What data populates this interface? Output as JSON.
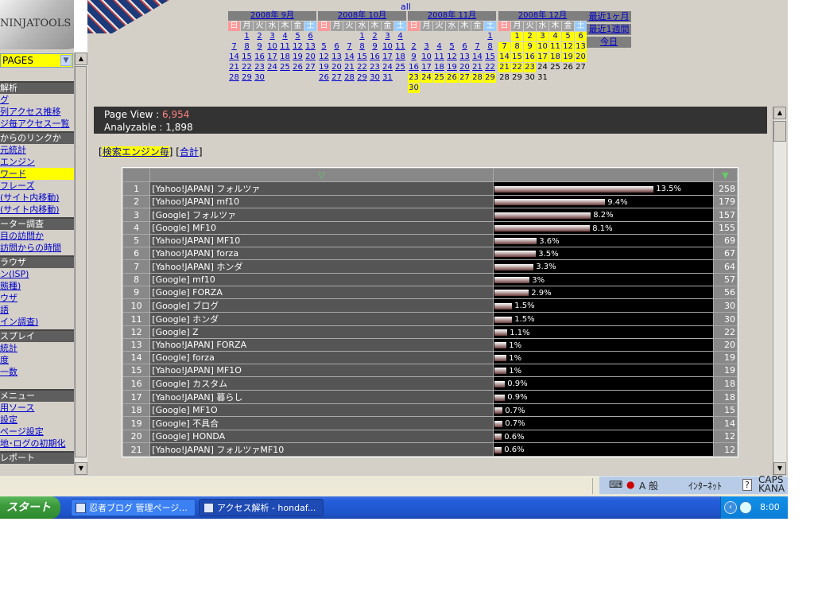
{
  "sidebar": {
    "logo_text": "NINJATOOLS",
    "page_select": "PAGES",
    "menu": [
      {
        "type": "head",
        "label": "解析"
      },
      {
        "type": "item",
        "label": "グ"
      },
      {
        "type": "item",
        "label": "列アクセス推移"
      },
      {
        "type": "item",
        "label": "ジ毎アクセス一覧"
      },
      {
        "type": "head",
        "label": "からのリンクか"
      },
      {
        "type": "item",
        "label": "元統計"
      },
      {
        "type": "item",
        "label": "エンジン"
      },
      {
        "type": "item",
        "label": "ワード",
        "highlight": true
      },
      {
        "type": "item",
        "label": "フレーズ"
      },
      {
        "type": "item",
        "label": "(サイト内移動)"
      },
      {
        "type": "item",
        "label": "(サイト内移動)"
      },
      {
        "type": "head",
        "label": "ーター調査"
      },
      {
        "type": "item",
        "label": "目の訪問か"
      },
      {
        "type": "item",
        "label": "訪問からの時間"
      },
      {
        "type": "head",
        "label": "ラウザ"
      },
      {
        "type": "item",
        "label": "ン(ISP)"
      },
      {
        "type": "item",
        "label": "態種)"
      },
      {
        "type": "item",
        "label": "ウザ"
      },
      {
        "type": "item",
        "label": "語"
      },
      {
        "type": "item",
        "label": "イン調査)"
      },
      {
        "type": "head",
        "label": "スプレイ"
      },
      {
        "type": "item",
        "label": "統計"
      },
      {
        "type": "item",
        "label": "度"
      },
      {
        "type": "item",
        "label": "一数"
      },
      {
        "type": "spacer",
        "label": ""
      },
      {
        "type": "head",
        "label": "メニュー"
      },
      {
        "type": "item",
        "label": "用ソース"
      },
      {
        "type": "item",
        "label": "設定"
      },
      {
        "type": "item",
        "label": "ページ設定"
      },
      {
        "type": "item",
        "label": "地･ログの初期化"
      },
      {
        "type": "head",
        "label": "レポート"
      }
    ]
  },
  "calendar": {
    "all_link": "all",
    "weekdays": [
      "日",
      "月",
      "火",
      "水",
      "木",
      "金",
      "土"
    ],
    "months": [
      {
        "title": "2008年 9月",
        "weeks": [
          [
            "",
            "1",
            "2",
            "3",
            "4",
            "5",
            "6"
          ],
          [
            "7",
            "8",
            "9",
            "10",
            "11",
            "12",
            "13"
          ],
          [
            "14",
            "15",
            "16",
            "17",
            "18",
            "19",
            "20"
          ],
          [
            "21",
            "22",
            "23",
            "24",
            "25",
            "26",
            "27"
          ],
          [
            "28",
            "29",
            "30",
            "",
            "",
            "",
            ""
          ]
        ],
        "yellow": [],
        "dark": []
      },
      {
        "title": "2008年 10月",
        "weeks": [
          [
            "",
            "",
            "",
            "1",
            "2",
            "3",
            "4"
          ],
          [
            "5",
            "6",
            "7",
            "8",
            "9",
            "10",
            "11"
          ],
          [
            "12",
            "13",
            "14",
            "15",
            "16",
            "17",
            "18"
          ],
          [
            "19",
            "20",
            "21",
            "22",
            "23",
            "24",
            "25"
          ],
          [
            "26",
            "27",
            "28",
            "29",
            "30",
            "31",
            ""
          ]
        ],
        "yellow": [],
        "dark": []
      },
      {
        "title": "2008年 11月",
        "weeks": [
          [
            "",
            "",
            "",
            "",
            "",
            "",
            "1"
          ],
          [
            "2",
            "3",
            "4",
            "5",
            "6",
            "7",
            "8"
          ],
          [
            "9",
            "10",
            "11",
            "12",
            "13",
            "14",
            "15"
          ],
          [
            "16",
            "17",
            "18",
            "19",
            "20",
            "21",
            "22"
          ],
          [
            "23",
            "24",
            "25",
            "26",
            "27",
            "28",
            "29"
          ],
          [
            "30",
            "",
            "",
            "",
            "",
            "",
            ""
          ]
        ],
        "yellow": [
          "23",
          "24",
          "25",
          "26",
          "27",
          "28",
          "29",
          "30"
        ],
        "dark": []
      },
      {
        "title": "2008年 12月",
        "weeks": [
          [
            "",
            "1",
            "2",
            "3",
            "4",
            "5",
            "6"
          ],
          [
            "7",
            "8",
            "9",
            "10",
            "11",
            "12",
            "13"
          ],
          [
            "14",
            "15",
            "16",
            "17",
            "18",
            "19",
            "20"
          ],
          [
            "21",
            "22",
            "23",
            "24",
            "25",
            "26",
            "27"
          ],
          [
            "28",
            "29",
            "30",
            "31",
            "",
            "",
            ""
          ]
        ],
        "yellow": [
          "1",
          "2",
          "3",
          "4",
          "5",
          "6",
          "7",
          "8",
          "9",
          "10",
          "11",
          "12",
          "13",
          "14",
          "15",
          "16",
          "17",
          "18",
          "19",
          "20",
          "21",
          "22",
          "23"
        ],
        "dark": [
          "24",
          "25",
          "26",
          "27",
          "28",
          "29",
          "30",
          "31"
        ]
      }
    ],
    "quick": [
      "最近1ヶ月",
      "最近1週間",
      "今日"
    ]
  },
  "summary": {
    "pv_label": "Page View : ",
    "pv_value": "6,954",
    "an_label": "Analyzable : ",
    "an_value": "1,898"
  },
  "tabs": {
    "active": "検索エンジン毎",
    "other": "合計"
  },
  "table": {
    "rows": [
      {
        "n": "1",
        "k": "[Yahoo!JAPAN] フォルツァ",
        "p": 13.5,
        "pl": "13.5%",
        "c": "258"
      },
      {
        "n": "2",
        "k": "[Yahoo!JAPAN] mf10",
        "p": 9.4,
        "pl": "9.4%",
        "c": "179"
      },
      {
        "n": "3",
        "k": "[Google] フォルツァ",
        "p": 8.2,
        "pl": "8.2%",
        "c": "157"
      },
      {
        "n": "4",
        "k": "[Google] MF10",
        "p": 8.1,
        "pl": "8.1%",
        "c": "155"
      },
      {
        "n": "5",
        "k": "[Yahoo!JAPAN] MF10",
        "p": 3.6,
        "pl": "3.6%",
        "c": "69"
      },
      {
        "n": "6",
        "k": "[Yahoo!JAPAN] forza",
        "p": 3.5,
        "pl": "3.5%",
        "c": "67"
      },
      {
        "n": "7",
        "k": "[Yahoo!JAPAN] ホンダ",
        "p": 3.3,
        "pl": "3.3%",
        "c": "64"
      },
      {
        "n": "8",
        "k": "[Google] mf10",
        "p": 3.0,
        "pl": "3%",
        "c": "57"
      },
      {
        "n": "9",
        "k": "[Google] FORZA",
        "p": 2.9,
        "pl": "2.9%",
        "c": "56"
      },
      {
        "n": "10",
        "k": "[Google] ブログ",
        "p": 1.5,
        "pl": "1.5%",
        "c": "30"
      },
      {
        "n": "11",
        "k": "[Google] ホンダ",
        "p": 1.5,
        "pl": "1.5%",
        "c": "30"
      },
      {
        "n": "12",
        "k": "[Google] Z",
        "p": 1.1,
        "pl": "1.1%",
        "c": "22"
      },
      {
        "n": "13",
        "k": "[Yahoo!JAPAN] FORZA",
        "p": 1.0,
        "pl": "1%",
        "c": "20"
      },
      {
        "n": "14",
        "k": "[Google] forza",
        "p": 1.0,
        "pl": "1%",
        "c": "19"
      },
      {
        "n": "15",
        "k": "[Yahoo!JAPAN] MF1O",
        "p": 1.0,
        "pl": "1%",
        "c": "19"
      },
      {
        "n": "16",
        "k": "[Google] カスタム",
        "p": 0.9,
        "pl": "0.9%",
        "c": "18"
      },
      {
        "n": "17",
        "k": "[Yahoo!JAPAN] 暮らし",
        "p": 0.9,
        "pl": "0.9%",
        "c": "18"
      },
      {
        "n": "18",
        "k": "[Google] MF1O",
        "p": 0.7,
        "pl": "0.7%",
        "c": "15"
      },
      {
        "n": "19",
        "k": "[Google] 不具合",
        "p": 0.7,
        "pl": "0.7%",
        "c": "14"
      },
      {
        "n": "20",
        "k": "[Google] HONDA",
        "p": 0.6,
        "pl": "0.6%",
        "c": "12"
      },
      {
        "n": "21",
        "k": "[Yahoo!JAPAN] フォルツァMF10",
        "p": 0.6,
        "pl": "0.6%",
        "c": "12"
      }
    ]
  },
  "tray": {
    "ime": "A 般",
    "ime2": "ｲﾝﾀｰﾈｯﾄ",
    "caps": "CAPS",
    "kana": "KANA"
  },
  "taskbar": {
    "start": "スタート",
    "tasks": [
      "忍者ブログ 管理ページ...",
      "アクセス解析 - hondaf..."
    ],
    "clock": "8:00"
  }
}
